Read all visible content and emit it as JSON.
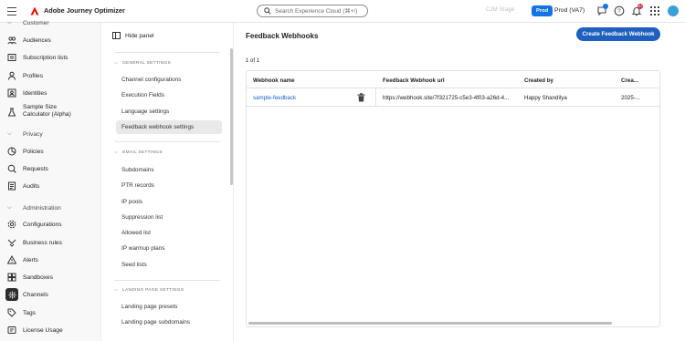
{
  "topbar": {
    "app_title": "Adobe Journey Optimizer",
    "search_placeholder": "Search Experience Cloud (⌘+/)",
    "sandbox_blurred": "CJM Stage",
    "prod_badge": "Prod",
    "prod_label": "Prod (VA7)",
    "notification_count": "9+",
    "brand_color": "#eb1000",
    "accent_color": "#1473e6"
  },
  "leftnav": {
    "items": [
      {
        "label": "Customer",
        "icon": "customer-icon"
      },
      {
        "label": "Audiences",
        "icon": "audiences-icon"
      },
      {
        "label": "Subscription lists",
        "icon": "subscription-lists-icon"
      },
      {
        "label": "Profiles",
        "icon": "profiles-icon"
      },
      {
        "label": "Identities",
        "icon": "identities-icon"
      },
      {
        "label": "Sample Size Calculator (Alpha)",
        "icon": "calculator-icon"
      },
      {
        "label": "Privacy",
        "icon": "chevron-down-icon"
      },
      {
        "label": "Policies",
        "icon": "policies-icon"
      },
      {
        "label": "Requests",
        "icon": "requests-icon"
      },
      {
        "label": "Audits",
        "icon": "audits-icon"
      },
      {
        "label": "Administration",
        "icon": "chevron-down-icon"
      },
      {
        "label": "Configurations",
        "icon": "configurations-icon"
      },
      {
        "label": "Business rules",
        "icon": "business-rules-icon"
      },
      {
        "label": "Alerts",
        "icon": "alerts-icon"
      },
      {
        "label": "Sandboxes",
        "icon": "sandboxes-icon"
      },
      {
        "label": "Channels",
        "icon": "channels-icon"
      },
      {
        "label": "Tags",
        "icon": "tags-icon"
      },
      {
        "label": "License Usage",
        "icon": "license-usage-icon"
      }
    ]
  },
  "panel": {
    "hide_label": "Hide panel",
    "sections": [
      {
        "title": "GENERAL SETTINGS",
        "items": [
          "Channel configurations",
          "Execution Fields",
          "Language settings",
          "Feedback webhook settings"
        ]
      },
      {
        "title": "EMAIL SETTINGS",
        "items": [
          "Subdomains",
          "PTR records",
          "IP pools",
          "Suppression list",
          "Allowed list",
          "IP warmup plans",
          "Seed lists"
        ]
      },
      {
        "title": "LANDING PAGE SETTINGS",
        "items": [
          "Landing page presets",
          "Landing page subdomains"
        ]
      }
    ],
    "selected_item": "Feedback webhook settings"
  },
  "main": {
    "title": "Feedback Webhooks",
    "create_button": "Create Feedback Webhook",
    "count_text": "1 of 1",
    "columns": [
      "Webhook name",
      "Feedback Webhook url",
      "Created by",
      "Crea..."
    ],
    "rows": [
      {
        "name": "sample-feedback",
        "url": "https://webhook.site/7f321725-c5e3-4f03-a26d-4...",
        "created_by": "Happy Shandilya",
        "created": "2025-..."
      }
    ]
  }
}
